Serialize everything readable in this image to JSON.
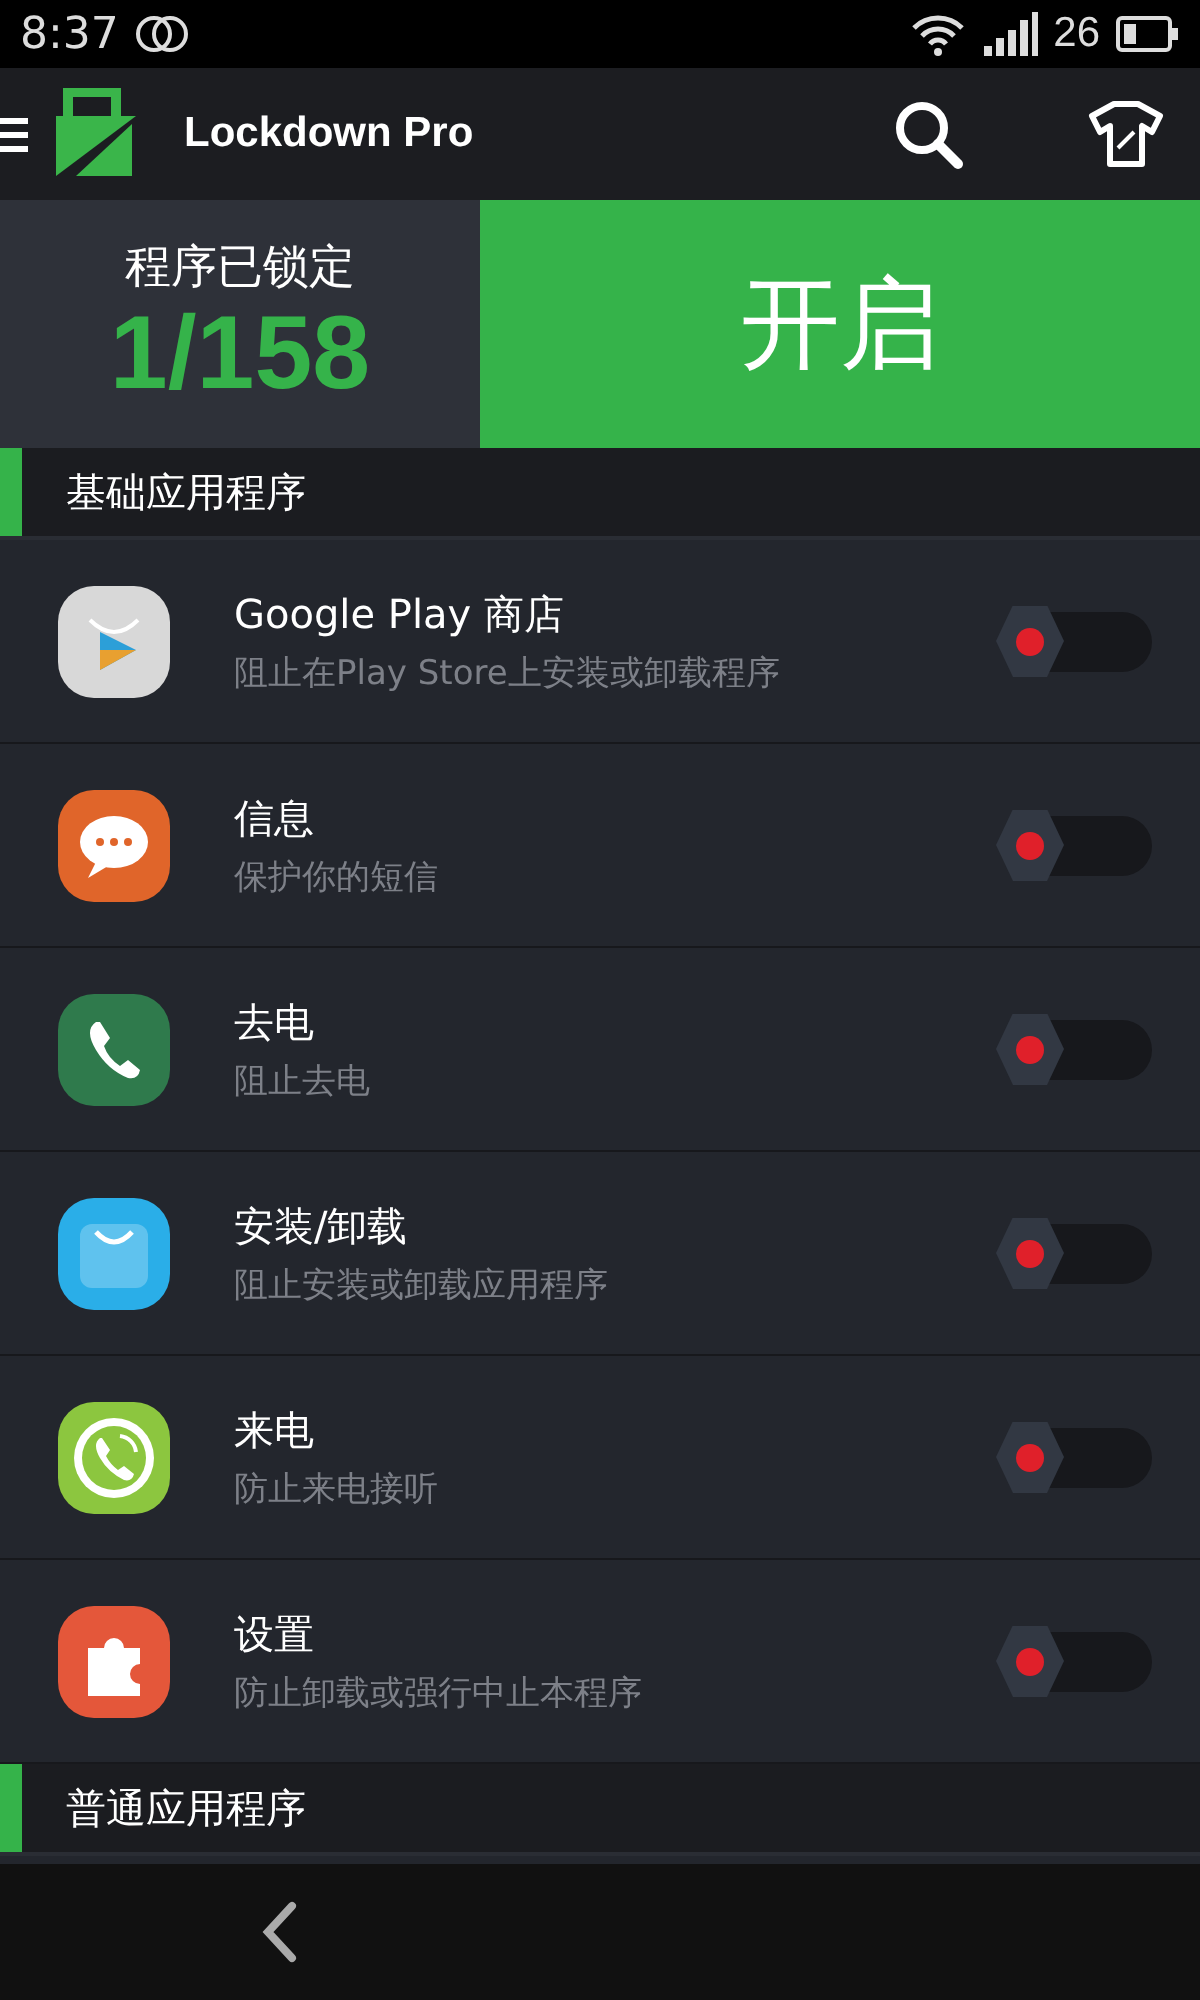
{
  "status_bar": {
    "time": "8:37",
    "battery": "26"
  },
  "app_bar": {
    "title": "Lockdown Pro"
  },
  "summary": {
    "label": "程序已锁定",
    "count": "1/158",
    "button": "开启"
  },
  "sections": [
    {
      "title": "基础应用程序",
      "items": [
        {
          "kind": "store",
          "name": "Google Play 商店",
          "description": "阻止在Play Store上安装或卸载程序",
          "on": false
        },
        {
          "kind": "chat",
          "name": "信息",
          "description": "保护你的短信",
          "on": false
        },
        {
          "kind": "phone",
          "name": "去电",
          "description": "阻止去电",
          "on": false
        },
        {
          "kind": "bag",
          "name": "安装/卸载",
          "description": "阻止安装或卸载应用程序",
          "on": false
        },
        {
          "kind": "incoming",
          "name": "来电",
          "description": "防止来电接听",
          "on": false
        },
        {
          "kind": "puzzle",
          "name": "设置",
          "description": "防止卸载或强行中止本程序",
          "on": false
        }
      ]
    },
    {
      "title": "普通应用程序"
    }
  ]
}
